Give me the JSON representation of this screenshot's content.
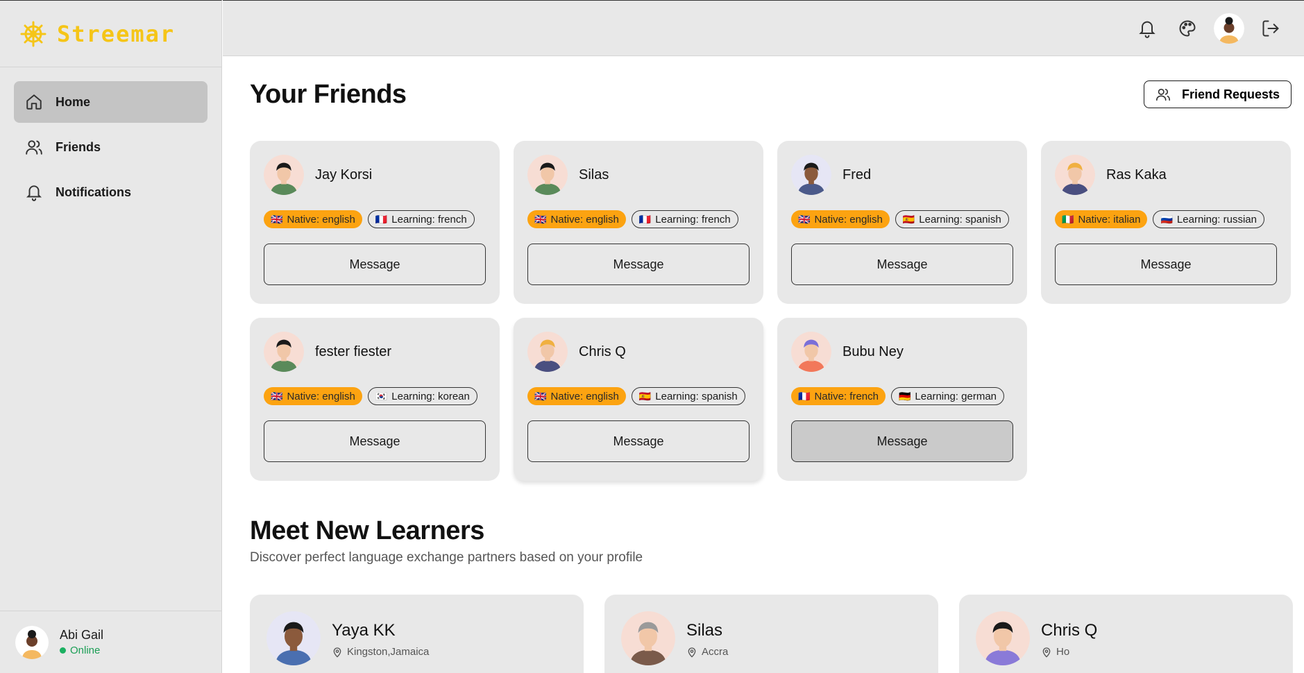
{
  "app": {
    "name": "Streemar",
    "brand_color": "#f5c518"
  },
  "sidebar": {
    "items": [
      {
        "label": "Home",
        "icon": "home-icon",
        "active": true
      },
      {
        "label": "Friends",
        "icon": "users-icon",
        "active": false
      },
      {
        "label": "Notifications",
        "icon": "bell-icon",
        "active": false
      }
    ],
    "user": {
      "name": "Abi Gail",
      "status": "Online"
    }
  },
  "topbar": {
    "icons": [
      "bell-icon",
      "palette-icon",
      "avatar",
      "logout-icon"
    ]
  },
  "friends_section": {
    "title": "Your Friends",
    "requests_button": "Friend Requests",
    "friends": [
      {
        "name": "Jay Korsi",
        "native": "Native: english",
        "native_flag": "🇬🇧",
        "learning": "Learning: french",
        "learning_flag": "🇫🇷",
        "button": "Message"
      },
      {
        "name": "Silas",
        "native": "Native: english",
        "native_flag": "🇬🇧",
        "learning": "Learning: french",
        "learning_flag": "🇫🇷",
        "button": "Message"
      },
      {
        "name": "Fred",
        "native": "Native: english",
        "native_flag": "🇬🇧",
        "learning": "Learning: spanish",
        "learning_flag": "🇪🇸",
        "button": "Message"
      },
      {
        "name": "Ras Kaka",
        "native": "Native: italian",
        "native_flag": "🇮🇹",
        "learning": "Learning: russian",
        "learning_flag": "🇷🇺",
        "button": "Message"
      },
      {
        "name": "fester fiester",
        "native": "Native: english",
        "native_flag": "🇬🇧",
        "learning": "Learning: korean",
        "learning_flag": "🇰🇷",
        "button": "Message"
      },
      {
        "name": "Chris Q",
        "native": "Native: english",
        "native_flag": "🇬🇧",
        "learning": "Learning: spanish",
        "learning_flag": "🇪🇸",
        "button": "Message"
      },
      {
        "name": "Bubu Ney",
        "native": "Native: french",
        "native_flag": "🇫🇷",
        "learning": "Learning: german",
        "learning_flag": "🇩🇪",
        "button": "Message"
      }
    ]
  },
  "learners_section": {
    "title": "Meet New Learners",
    "subtitle": "Discover perfect language exchange partners based on your profile",
    "learners": [
      {
        "name": "Yaya KK",
        "location": "Kingston,Jamaica"
      },
      {
        "name": "Silas",
        "location": "Accra"
      },
      {
        "name": "Chris Q",
        "location": "Ho"
      }
    ]
  },
  "colors": {
    "native_badge": "#fca311",
    "online": "#1bb061"
  }
}
